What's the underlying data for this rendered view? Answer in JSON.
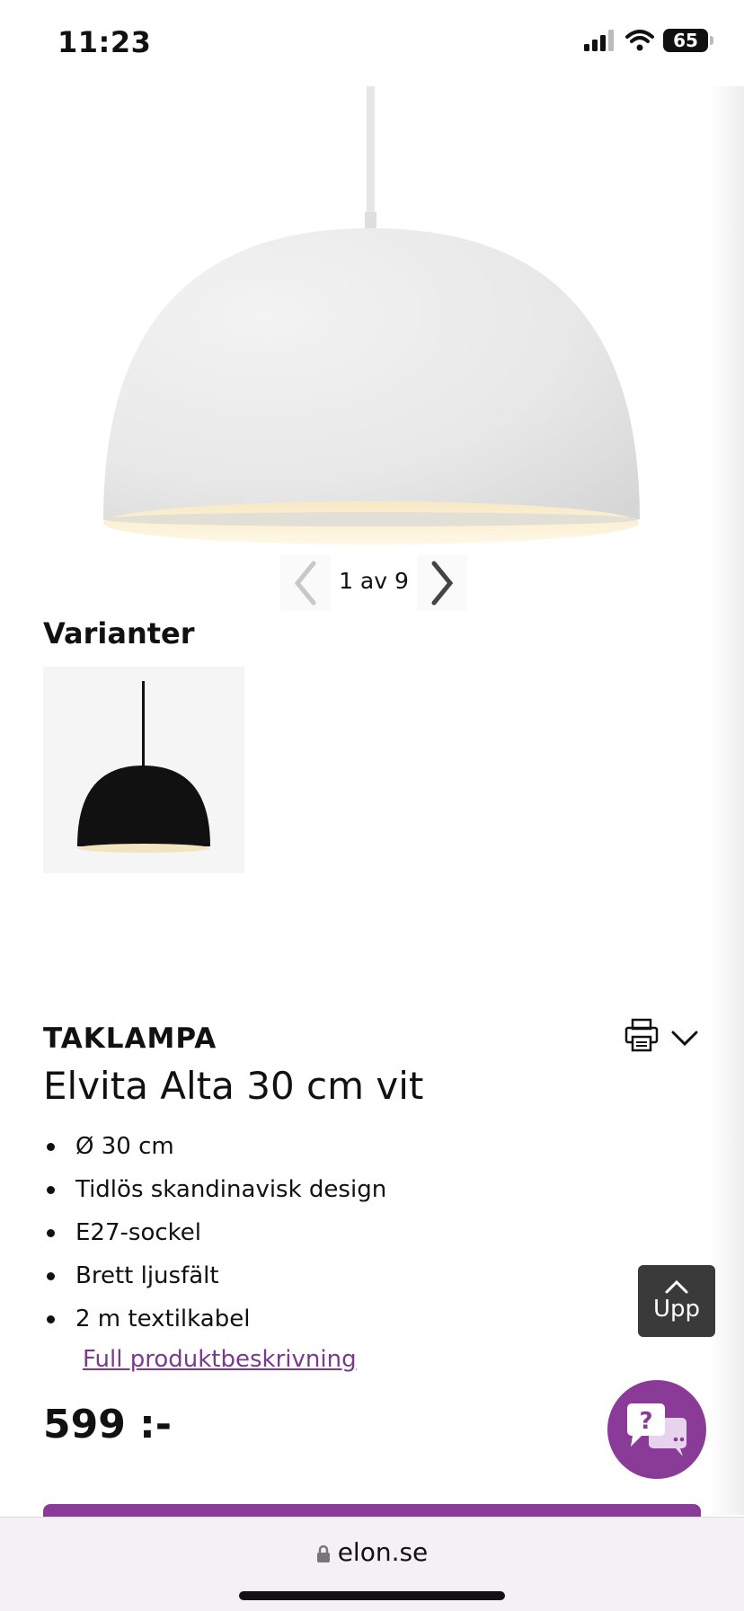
{
  "status": {
    "time": "11:23",
    "battery": "65"
  },
  "gallery": {
    "counter": "1 av 9"
  },
  "variants": {
    "title": "Varianter"
  },
  "product": {
    "category": "TAKLAMPA",
    "title": "Elvita Alta 30 cm vit",
    "features": [
      "Ø 30 cm",
      "Tidlös skandinavisk design",
      "E27-sockel",
      "Brett ljusfält",
      "2 m textilkabel"
    ],
    "full_description_link": "Full produktbeskrivning",
    "price": "599 :-"
  },
  "scroll_up": {
    "label": "Upp"
  },
  "browser": {
    "url": "elon.se"
  },
  "colors": {
    "accent": "#8a3b98",
    "link": "#7a3a8e",
    "dark_button": "#3a3a3a"
  }
}
